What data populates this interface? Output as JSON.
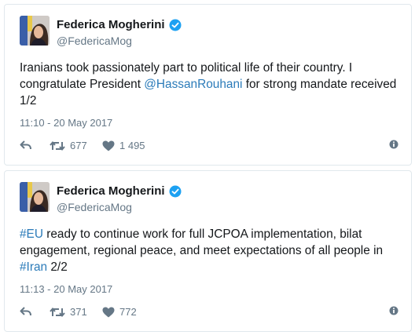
{
  "tweets": [
    {
      "author_name": "Federica Mogherini",
      "handle": "@FedericaMog",
      "text_parts": [
        {
          "text": "Iranians took passionately part to political life of their country. I congratulate President ",
          "link": false
        },
        {
          "text": "@HassanRouhani",
          "link": true
        },
        {
          "text": " for strong mandate received 1/2",
          "link": false
        }
      ],
      "timestamp": "11:10 - 20 May 2017",
      "retweets": "677",
      "likes": "1 495"
    },
    {
      "author_name": "Federica Mogherini",
      "handle": "@FedericaMog",
      "text_parts": [
        {
          "text": "#EU",
          "link": true
        },
        {
          "text": " ready to continue work for full JCPOA implementation, bilat engagement, regional peace, and meet expectations of all people in ",
          "link": false
        },
        {
          "text": "#Iran",
          "link": true
        },
        {
          "text": " 2/2",
          "link": false
        }
      ],
      "timestamp": "11:13 - 20 May 2017",
      "retweets": "371",
      "likes": "772"
    }
  ],
  "colors": {
    "text": "#14171a",
    "secondary": "#657786",
    "link": "#2b7bb9",
    "verified": "#1da1f2",
    "border": "#e1e8ed"
  },
  "icons": [
    "avatar",
    "verified-badge-icon",
    "reply-icon",
    "retweet-icon",
    "heart-icon",
    "info-icon"
  ]
}
